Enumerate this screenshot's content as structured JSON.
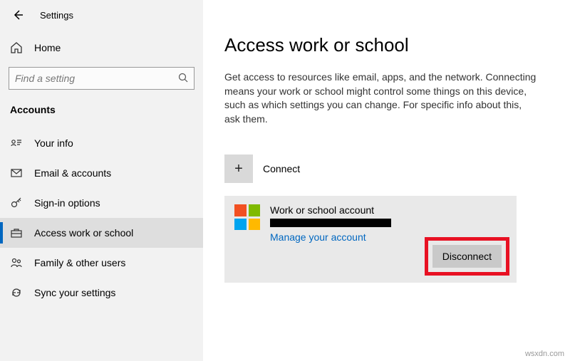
{
  "header": {
    "app_title": "Settings",
    "home_label": "Home",
    "search_placeholder": "Find a setting",
    "section_label": "Accounts"
  },
  "sidebar": {
    "items": [
      {
        "label": "Your info"
      },
      {
        "label": "Email & accounts"
      },
      {
        "label": "Sign-in options"
      },
      {
        "label": "Access work or school"
      },
      {
        "label": "Family & other users"
      },
      {
        "label": "Sync your settings"
      }
    ]
  },
  "main": {
    "heading": "Access work or school",
    "description": "Get access to resources like email, apps, and the network. Connecting means your work or school might control some things on this device, such as which settings you can change. For specific info about this, ask them.",
    "connect_label": "Connect",
    "account": {
      "title": "Work or school account",
      "manage_label": "Manage your account",
      "disconnect_label": "Disconnect"
    }
  },
  "watermark": "wsxdn.com"
}
